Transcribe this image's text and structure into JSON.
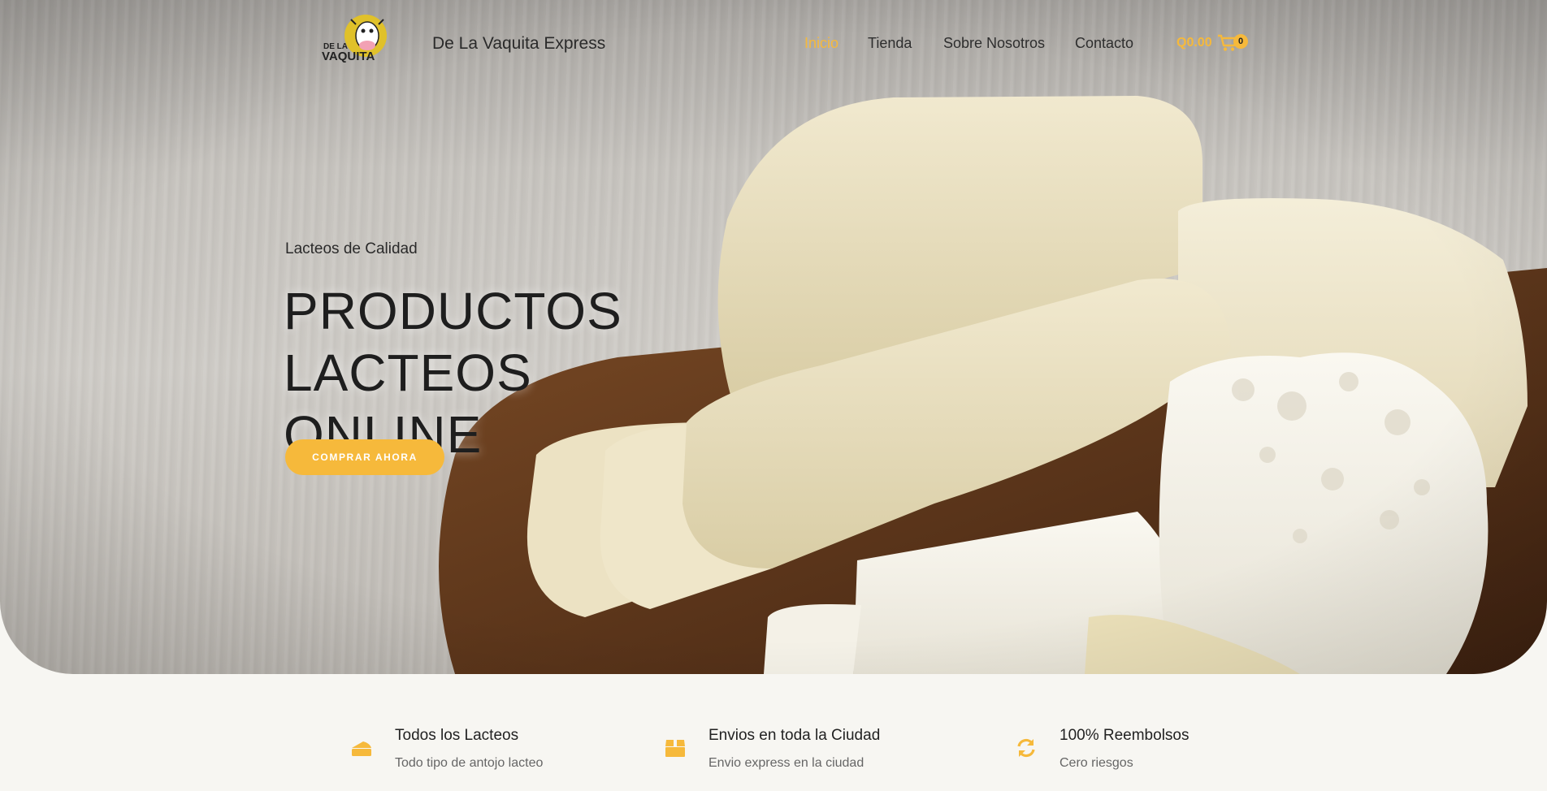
{
  "brand": {
    "logo_text_line1": "DE LA",
    "logo_text_line2": "VAQUITA",
    "site_title": "De La Vaquita Express"
  },
  "nav": {
    "items": [
      {
        "label": "Inicio",
        "active": true
      },
      {
        "label": "Tienda",
        "active": false
      },
      {
        "label": "Sobre Nosotros",
        "active": false
      },
      {
        "label": "Contacto",
        "active": false
      }
    ]
  },
  "cart": {
    "total": "Q0.00",
    "count": "0",
    "icon": "shopping-cart-icon"
  },
  "hero": {
    "subtitle": "Lacteos de Calidad",
    "headline_line1": "PRODUCTOS",
    "headline_line2": "LACTEOS ONLINE",
    "cta_label": "COMPRAR AHORA"
  },
  "features": [
    {
      "icon": "cheese-icon",
      "title": "Todos los Lacteos",
      "text": "Todo tipo de antojo lacteo"
    },
    {
      "icon": "box-icon",
      "title": "Envios en toda la Ciudad",
      "text": "Envio express en la ciudad"
    },
    {
      "icon": "refresh-icon",
      "title": "100% Reembolsos",
      "text": "Cero riesgos"
    }
  ],
  "colors": {
    "accent": "#f6b93b",
    "page_background": "#f7f6f2"
  }
}
